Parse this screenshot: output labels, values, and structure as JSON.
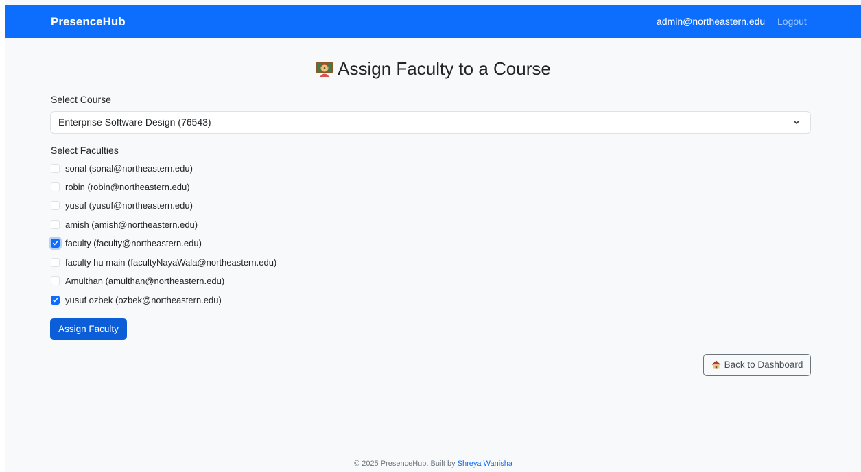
{
  "navbar": {
    "brand": "PresenceHub",
    "user_email": "admin@northeastern.edu",
    "logout_label": "Logout"
  },
  "page": {
    "title": "Assign Faculty to a Course",
    "title_icon": "teacher-emoji-icon"
  },
  "course_select": {
    "label": "Select Course",
    "selected_value": "Enterprise Software Design (76543)"
  },
  "faculty_list": {
    "label": "Select Faculties",
    "items": [
      {
        "label": "sonal (sonal@northeastern.edu)",
        "checked": false
      },
      {
        "label": "robin (robin@northeastern.edu)",
        "checked": false
      },
      {
        "label": "yusuf (yusuf@northeastern.edu)",
        "checked": false
      },
      {
        "label": "amish (amish@northeastern.edu)",
        "checked": false
      },
      {
        "label": "faculty (faculty@northeastern.edu)",
        "checked": true
      },
      {
        "label": "faculty hu main (facultyNayaWala@northeastern.edu)",
        "checked": false
      },
      {
        "label": "Amulthan (amulthan@northeastern.edu)",
        "checked": false
      },
      {
        "label": "yusuf ozbek (ozbek@northeastern.edu)",
        "checked": true
      }
    ]
  },
  "actions": {
    "assign_label": "Assign Faculty",
    "back_label": "Back to Dashboard",
    "back_icon": "house-icon"
  },
  "footer": {
    "text": "© 2025 PresenceHub. Built by",
    "author_link": "Shreya Wanisha"
  },
  "colors": {
    "primary": "#0d6efd",
    "background": "#f8f9fa"
  }
}
